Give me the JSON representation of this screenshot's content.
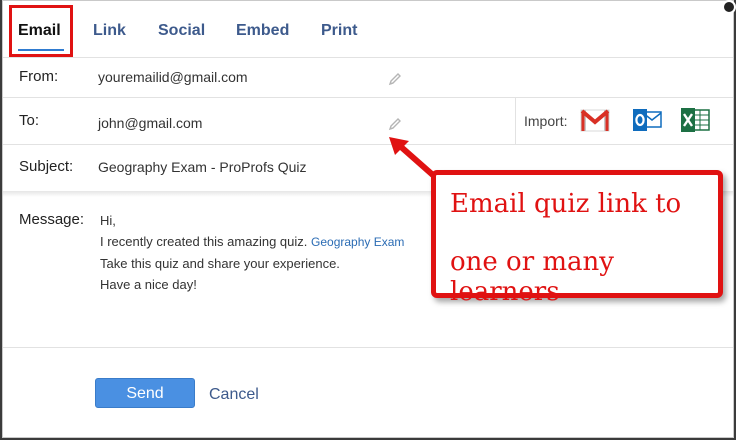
{
  "tabs": [
    {
      "label": "Email",
      "active": true
    },
    {
      "label": "Link",
      "active": false
    },
    {
      "label": "Social",
      "active": false
    },
    {
      "label": "Embed",
      "active": false
    },
    {
      "label": "Print",
      "active": false
    }
  ],
  "from": {
    "label": "From:",
    "value": "youremailid@gmail.com"
  },
  "to": {
    "label": "To:",
    "value": "john@gmail.com"
  },
  "import": {
    "label": "Import:",
    "icons": [
      "gmail-icon",
      "outlook-icon",
      "excel-icon"
    ]
  },
  "subject": {
    "label": "Subject:",
    "value": "Geography Exam - ProProfs Quiz"
  },
  "message": {
    "label": "Message:",
    "line1": "Hi,",
    "line2": "I recently created this amazing quiz.",
    "link": "Geography Exam",
    "line3": "Take this quiz and share your experience.",
    "line4": "Have a nice day!"
  },
  "actions": {
    "send": "Send",
    "cancel": "Cancel"
  },
  "callout": {
    "line1": "Email quiz link to",
    "line2": "one or many learners"
  },
  "colors": {
    "accent": "#4a90e2",
    "annotation": "#e01212",
    "tab_text": "#3d5a8c"
  }
}
